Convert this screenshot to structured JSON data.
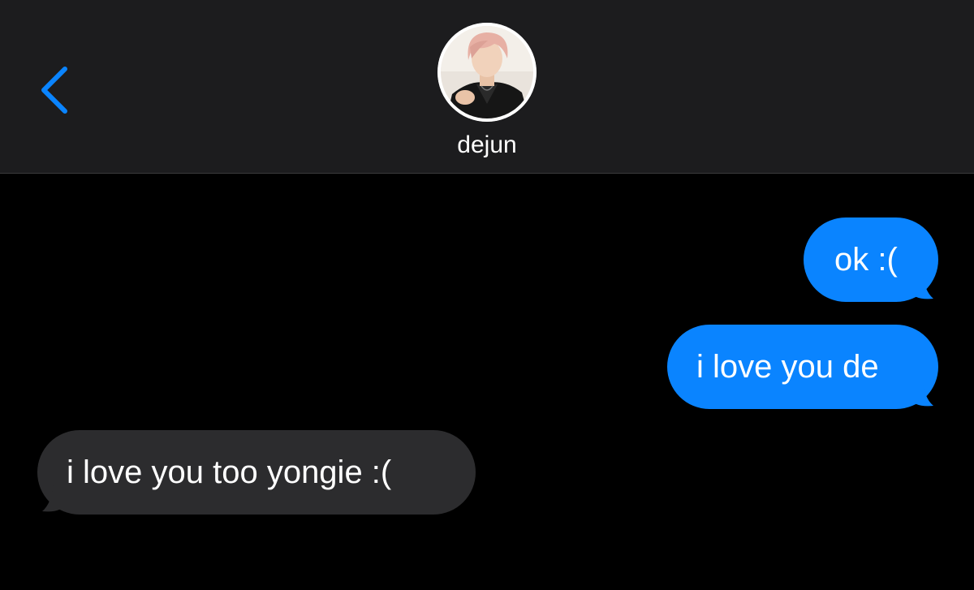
{
  "header": {
    "back_icon": "chevron-left-icon",
    "contact": {
      "name": "dejun",
      "avatar": "contact-photo"
    }
  },
  "colors": {
    "header_bg": "#1c1c1e",
    "chat_bg": "#000000",
    "sent_bubble": "#0a84ff",
    "received_bubble": "#2c2c2e",
    "accent": "#0a84ff",
    "text": "#ffffff"
  },
  "messages": [
    {
      "direction": "sent",
      "text": "ok :("
    },
    {
      "direction": "sent",
      "text": "i love you de"
    },
    {
      "direction": "received",
      "text": "i love you too yongie :("
    }
  ]
}
